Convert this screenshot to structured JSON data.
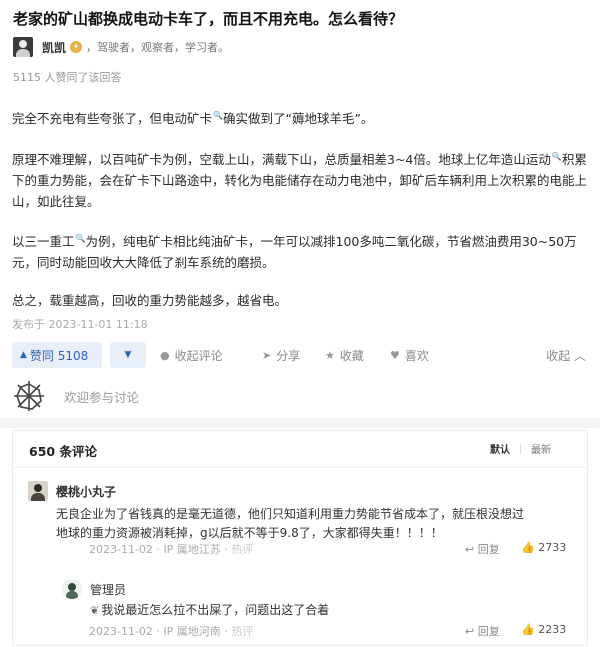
{
  "question": {
    "title": "老家的矿山都换成电动卡车了，而且不用充电。怎么看待？"
  },
  "author": {
    "name": "凯凯",
    "bio": "，驾驶者，观察者，学习者。"
  },
  "votes_summary": "5115 人赞同了该回答",
  "answer": {
    "p1_a": "完全不充电有些夸张了，但电动矿卡",
    "p1_b": "确实做到了“薅地球羊毛”。",
    "p2_a": "原理不难理解，以百吨矿卡为例，空载上山，满载下山，总质量相差3~4倍。地球上亿年造山运动",
    "p2_b": "积累下的重力势能，会在矿卡下山路途中，转化为电能储存在动力电池中，卸矿后车辆利用上次积累的电能上山，如此往复。",
    "p3_a": "以三一重工",
    "p3_b": "为例，纯电矿卡相比纯油矿卡，一年可以减排100多吨二氧化碳，节省燃油费用30~50万元，同时动能回收大大降低了刹车系统的磨损。",
    "p4": "总之，载重越高，回收的重力势能越多，越省电。"
  },
  "published": "发布于 2023-11-01 11:18",
  "actions": {
    "upvote": "赞同 5108",
    "comment": "收起评论",
    "share": "分享",
    "favorite": "收藏",
    "like": "喜欢",
    "collapse": "收起"
  },
  "discuss_placeholder": "欢迎参与讨论",
  "comments": {
    "count": "650 条评论",
    "sort_default": "默认",
    "sort_latest": "最新",
    "items": [
      {
        "name": "樱桃小丸子",
        "text": "无良企业为了省钱真的是毫无道德，他们只知道利用重力势能节省成本了，就压根没想过地球的重力资源被消耗掉，g以后就不等于9.8了，大家都得失重！！！！",
        "date": "2023-11-02",
        "location": "IP 属地江苏",
        "hot": "热评",
        "reply": "回复",
        "likes": "2733"
      },
      {
        "name": "管理员",
        "text": "我说最近怎么拉不出屎了，问题出这了合着",
        "date": "2023-11-02",
        "location": "IP 属地河南",
        "hot": "热评",
        "reply": "回复",
        "likes": "2233"
      }
    ]
  }
}
